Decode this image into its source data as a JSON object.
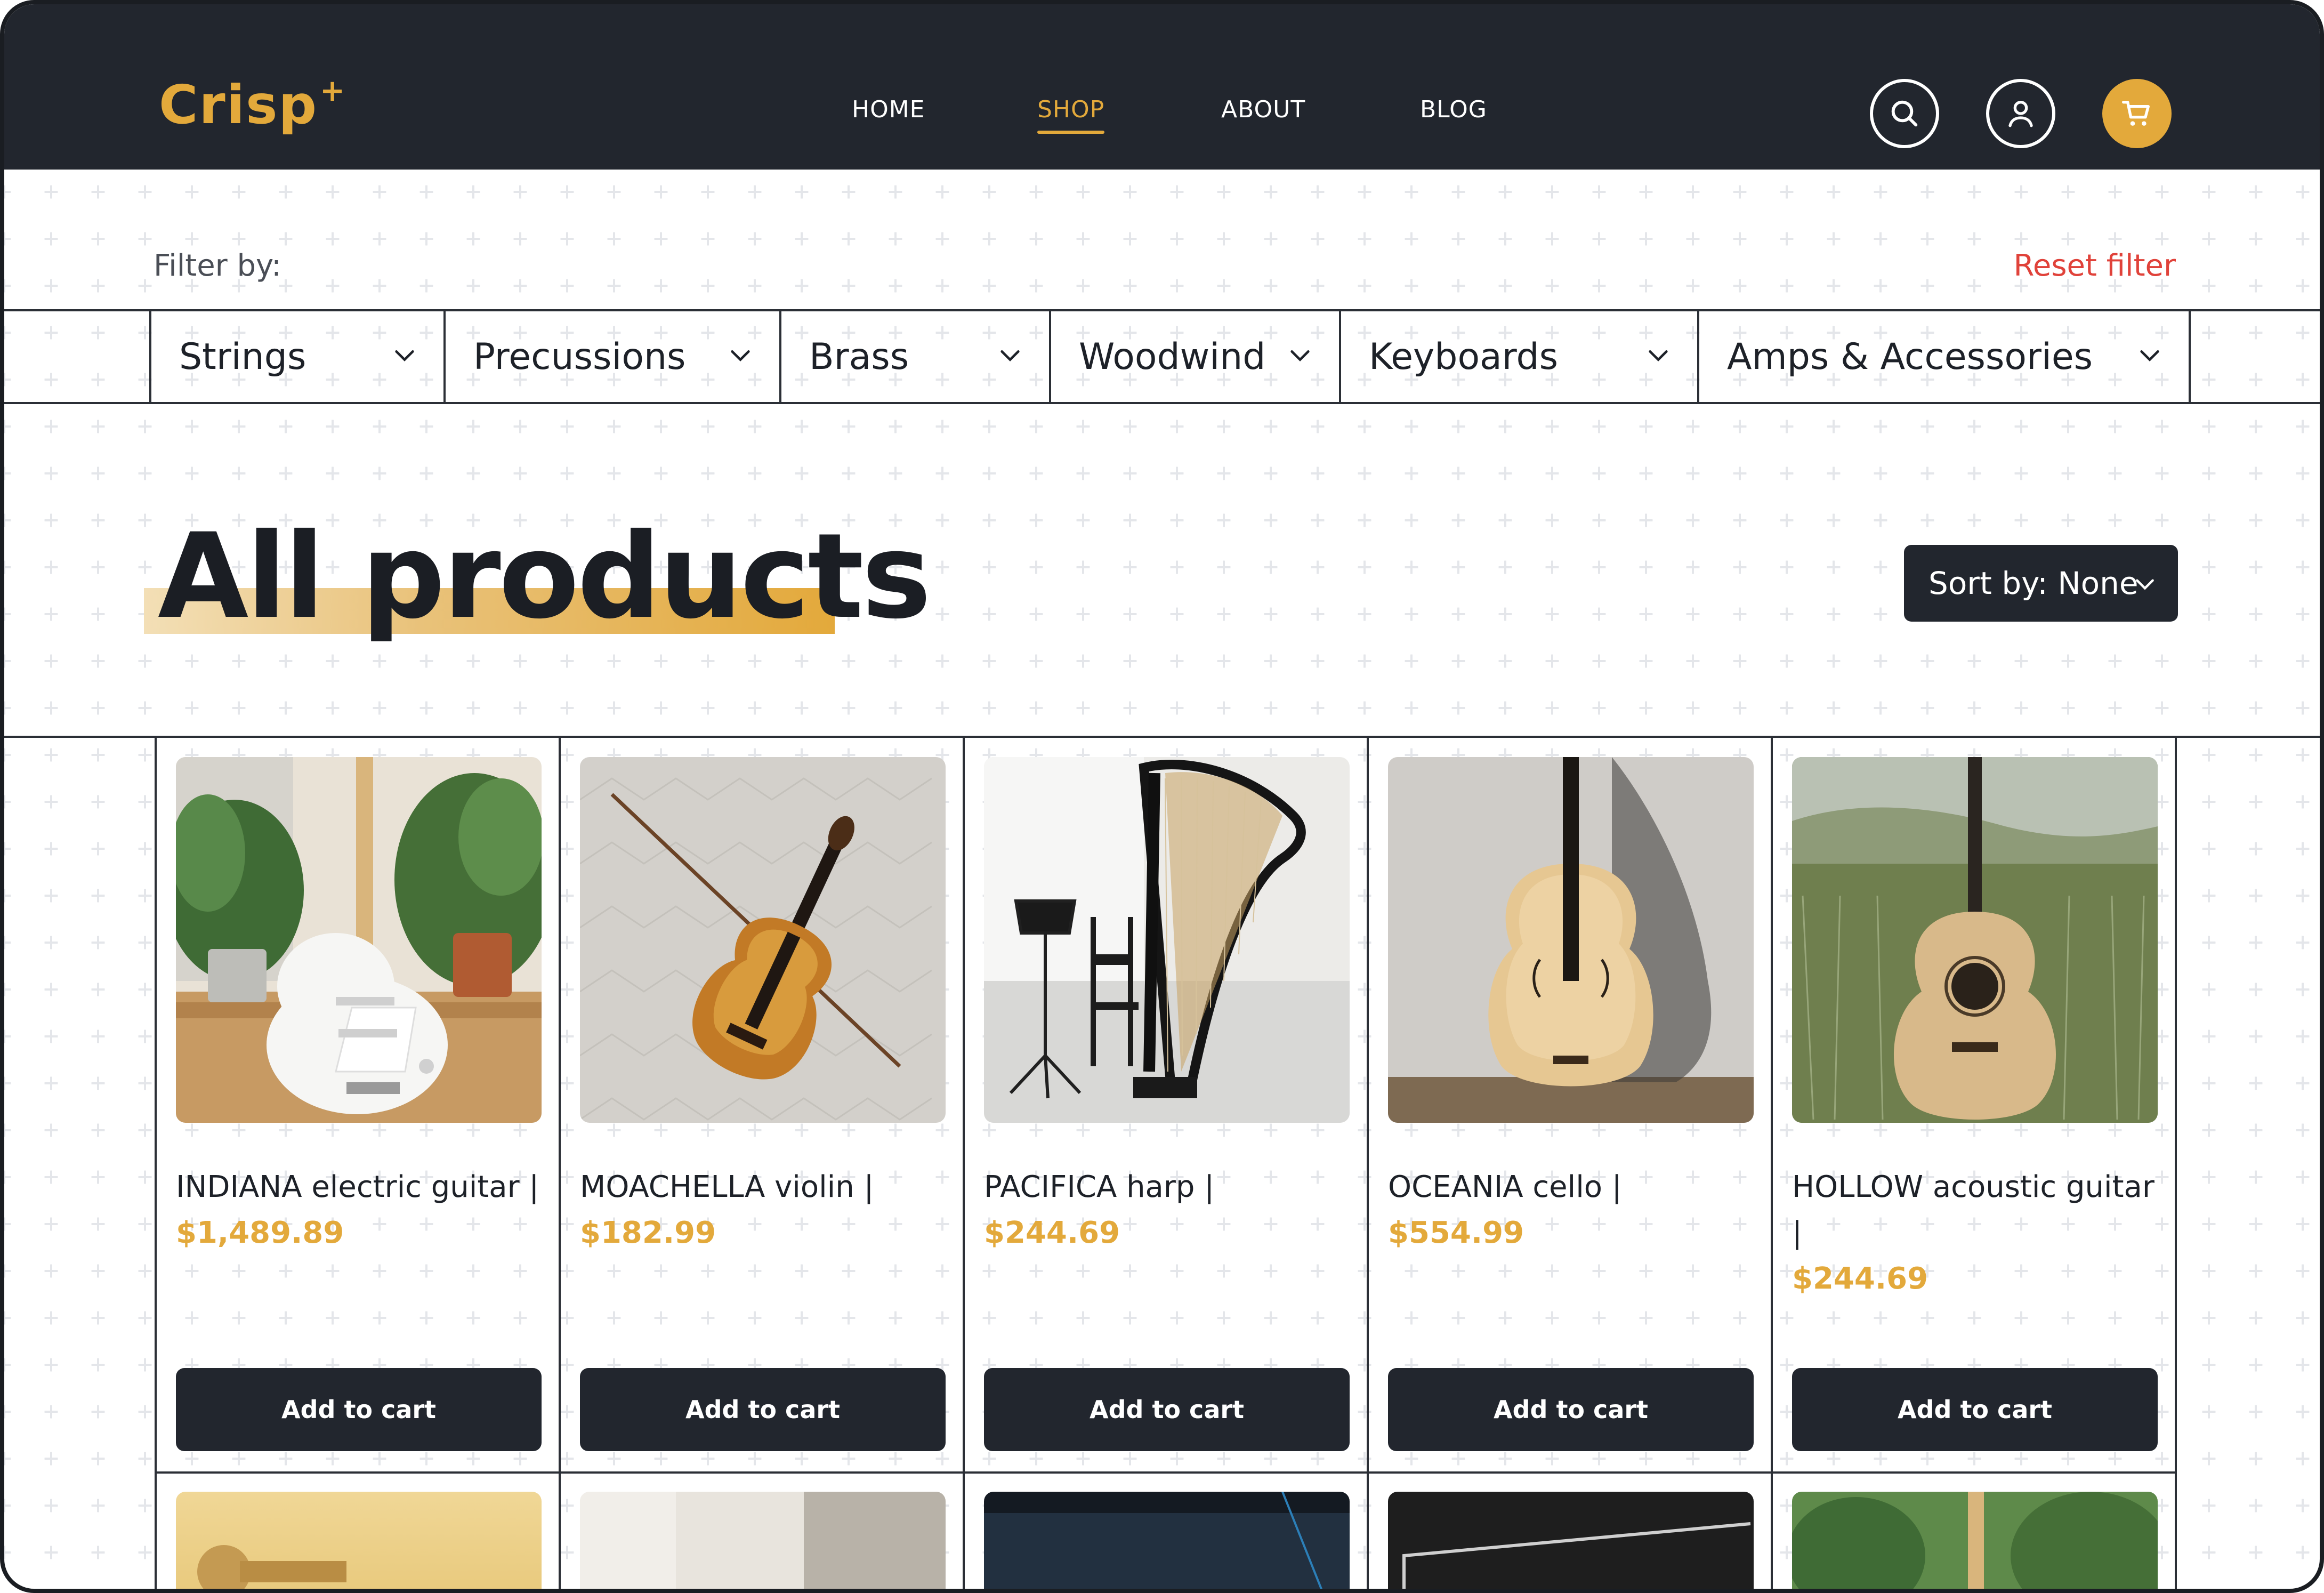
{
  "brand": {
    "name": "Crisp",
    "mark": "+"
  },
  "nav": {
    "items": [
      {
        "label": "HOME",
        "active": false
      },
      {
        "label": "SHOP",
        "active": true
      },
      {
        "label": "ABOUT",
        "active": false
      },
      {
        "label": "BLOG",
        "active": false
      }
    ]
  },
  "header_icons": [
    "search-icon",
    "user-icon",
    "cart-icon"
  ],
  "filter": {
    "label": "Filter by:",
    "reset_label": "Reset filter",
    "categories": [
      {
        "label": "Strings"
      },
      {
        "label": "Precussions"
      },
      {
        "label": "Brass"
      },
      {
        "label": "Woodwind"
      },
      {
        "label": "Keyboards"
      },
      {
        "label": "Amps & Accessories"
      }
    ]
  },
  "page_title": "All products",
  "sort": {
    "label": "Sort by: None"
  },
  "products": [
    {
      "name": "INDIANA electric guitar |",
      "price": "$1,489.89",
      "button": "Add to cart"
    },
    {
      "name": "MOACHELLA violin |",
      "price": "$182.99",
      "button": "Add to cart"
    },
    {
      "name": "PACIFICA harp |",
      "price": "$244.69",
      "button": "Add to cart"
    },
    {
      "name": "OCEANIA cello |",
      "price": "$554.99",
      "button": "Add to cart"
    },
    {
      "name": "HOLLOW acoustic guitar |",
      "price": "$244.69",
      "button": "Add to cart"
    }
  ],
  "colors": {
    "accent": "#e3a93b",
    "dark": "#22262e",
    "reset": "#e0423a"
  }
}
